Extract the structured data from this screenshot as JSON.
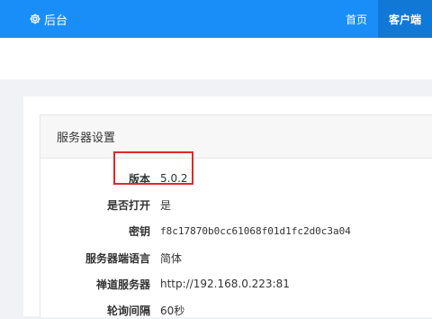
{
  "topbar": {
    "brand_label": "后台",
    "nav": [
      {
        "label": "首页"
      },
      {
        "label": "客户端"
      }
    ]
  },
  "card": {
    "title": "服务器设置",
    "rows": [
      {
        "label": "版本",
        "value": "5.0.2"
      },
      {
        "label": "是否打开",
        "value": "是"
      },
      {
        "label": "密钥",
        "value": "f8c17870b0cc61068f01d1fc2d0c3a04"
      },
      {
        "label": "服务器端语言",
        "value": "简体"
      },
      {
        "label": "禅道服务器",
        "value": "http://192.168.0.223:81"
      },
      {
        "label": "轮询间隔",
        "value": "60秒"
      }
    ]
  },
  "colors": {
    "accent": "#1a8ef8",
    "accent_active": "#1278d6",
    "highlight": "#e0282c"
  }
}
